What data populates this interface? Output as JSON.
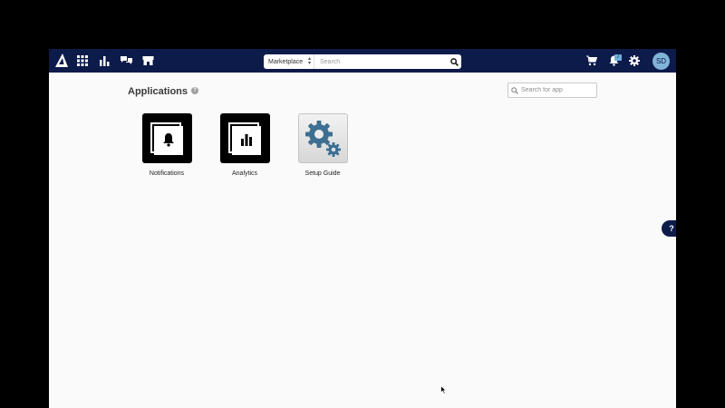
{
  "topbar": {
    "logo_icon": "brand-logo-icon",
    "nav_icons": [
      "apps-grid-icon",
      "bar-chart-icon",
      "chat-bubbles-icon",
      "storefront-icon"
    ],
    "search": {
      "scope_label": "Marketplace",
      "placeholder": "Search"
    },
    "cart_icon": "cart-icon",
    "notifications_badge": "7",
    "settings_icon": "gear-icon",
    "avatar_initials": "SD",
    "background": "#0d1b4b"
  },
  "main": {
    "title": "Applications",
    "help_mark": "?",
    "app_search_placeholder": "Search for app",
    "apps": [
      {
        "label": "Notifications",
        "icon": "bell-icon"
      },
      {
        "label": "Analytics",
        "icon": "bar-chart-icon"
      },
      {
        "label": "Setup Guide",
        "icon": "gears-icon"
      }
    ]
  },
  "floating_help": {
    "label": "?"
  }
}
